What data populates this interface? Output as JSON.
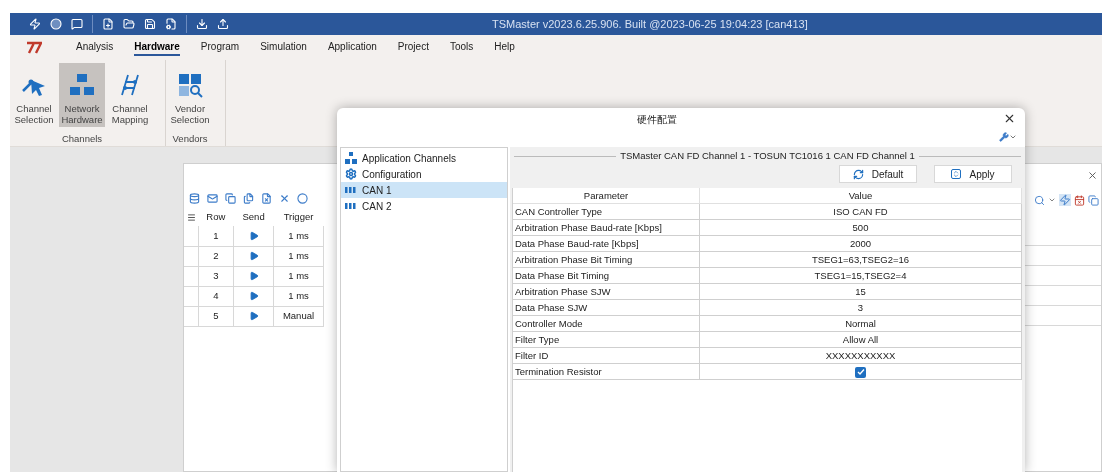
{
  "title_bar": {
    "title": "TSMaster v2023.6.25.906. Built @2023-06-25 19:04:23 [can413]"
  },
  "menu": [
    {
      "label": "Analysis",
      "selected": false
    },
    {
      "label": "Hardware",
      "selected": true
    },
    {
      "label": "Program",
      "selected": false
    },
    {
      "label": "Simulation",
      "selected": false
    },
    {
      "label": "Application",
      "selected": false
    },
    {
      "label": "Project",
      "selected": false
    },
    {
      "label": "Tools",
      "selected": false
    },
    {
      "label": "Help",
      "selected": false
    }
  ],
  "ribbon": [
    {
      "label": "Channels",
      "buttons": [
        {
          "label": "Channel Selection",
          "kind": "pointer",
          "selected": false
        },
        {
          "label": "Network Hardware",
          "kind": "network",
          "selected": true
        },
        {
          "label": "Channel Mapping",
          "kind": "mapping",
          "selected": false
        }
      ]
    },
    {
      "label": "Vendors",
      "buttons": [
        {
          "label": "Vendor Selection",
          "kind": "vendor",
          "selected": false
        }
      ]
    }
  ],
  "sender": {
    "columns": [
      "Row",
      "Send",
      "Trigger"
    ],
    "rows": [
      {
        "row": "1",
        "trigger": "1 ms"
      },
      {
        "row": "2",
        "trigger": "1 ms"
      },
      {
        "row": "3",
        "trigger": "1 ms"
      },
      {
        "row": "4",
        "trigger": "1 ms"
      },
      {
        "row": "5",
        "trigger": "Manual"
      }
    ]
  },
  "dialog": {
    "title": "硬件配置",
    "tree": [
      {
        "label": "Application Channels",
        "kind": "network",
        "selected": false
      },
      {
        "label": "Configuration",
        "kind": "gear",
        "selected": false
      },
      {
        "label": "CAN 1",
        "kind": "can",
        "selected": true
      },
      {
        "label": "CAN 2",
        "kind": "can",
        "selected": false
      }
    ],
    "group_title": "TSMaster CAN FD Channel 1 - TOSUN TC1016 1 CAN FD Channel 1",
    "buttons": [
      {
        "label": "Default",
        "kind": "default"
      },
      {
        "label": "Apply",
        "kind": "apply"
      }
    ],
    "columns": [
      "Parameter",
      "Value"
    ],
    "rows": [
      {
        "parameter": "CAN Controller Type",
        "kind": "text",
        "value": "ISO CAN FD"
      },
      {
        "parameter": "Arbitration Phase Baud-rate [Kbps]",
        "kind": "text",
        "value": "500"
      },
      {
        "parameter": "Data Phase Baud-rate [Kbps]",
        "kind": "text",
        "value": "2000"
      },
      {
        "parameter": "Arbitration Phase Bit Timing",
        "kind": "text",
        "value": "TSEG1=63,TSEG2=16"
      },
      {
        "parameter": "Data Phase Bit Timing",
        "kind": "text",
        "value": "TSEG1=15,TSEG2=4"
      },
      {
        "parameter": "Arbitration Phase SJW",
        "kind": "text",
        "value": "15"
      },
      {
        "parameter": "Data Phase SJW",
        "kind": "text",
        "value": "3"
      },
      {
        "parameter": "Controller Mode",
        "kind": "text",
        "value": "Normal"
      },
      {
        "parameter": "Filter Type",
        "kind": "text",
        "value": "Allow All"
      },
      {
        "parameter": "Filter ID",
        "kind": "text",
        "value": "XXXXXXXXXXX"
      },
      {
        "parameter": "Termination Resistor",
        "kind": "checkbox",
        "checked": true
      }
    ]
  }
}
